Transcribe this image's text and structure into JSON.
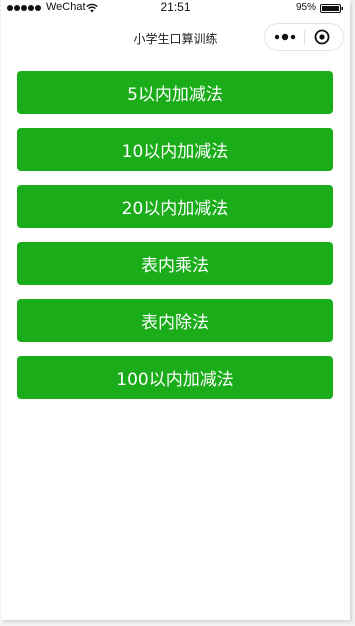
{
  "status_bar": {
    "carrier": "WeChat",
    "time": "21:51",
    "battery": "95%",
    "icons": [
      "signal-dots-icon",
      "wifi-icon",
      "battery-icon"
    ]
  },
  "nav_bar": {
    "title": "小学生口算训练",
    "capsule_icons": [
      "more-icon",
      "close-icon"
    ]
  },
  "menu": {
    "items": [
      {
        "label": "5以内加减法"
      },
      {
        "label": "10以内加减法"
      },
      {
        "label": "20以内加减法"
      },
      {
        "label": "表内乘法"
      },
      {
        "label": "表内除法"
      },
      {
        "label": "100以内加减法"
      }
    ]
  },
  "colors": {
    "button_green": "#1aad19",
    "button_text": "#ffffff",
    "background": "#ffffff"
  }
}
